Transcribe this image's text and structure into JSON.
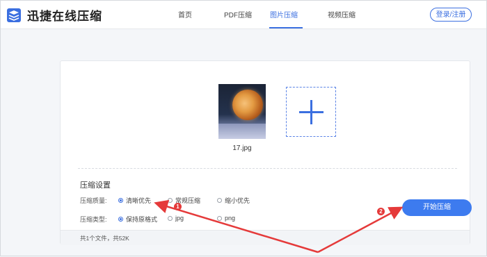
{
  "header": {
    "brand": "迅捷在线压缩",
    "nav": [
      {
        "label": "首页",
        "active": false
      },
      {
        "label": "PDF压缩",
        "active": false
      },
      {
        "label": "图片压缩",
        "active": true
      },
      {
        "label": "视频压缩",
        "active": false
      }
    ],
    "login_label": "登录/注册"
  },
  "upload": {
    "file_name": "17.jpg",
    "add_icon": "plus-icon"
  },
  "settings": {
    "title": "压缩设置",
    "quality_label": "压缩质量:",
    "quality_options": [
      {
        "label": "清晰优先",
        "selected": true
      },
      {
        "label": "常规压缩",
        "selected": false
      },
      {
        "label": "缩小优先",
        "selected": false
      }
    ],
    "type_label": "压缩类型:",
    "type_options": [
      {
        "label": "保持原格式",
        "selected": true
      },
      {
        "label": "jpg",
        "selected": false
      },
      {
        "label": "png",
        "selected": false
      }
    ],
    "start_label": "开始压缩"
  },
  "footer": {
    "summary": "共1个文件，共52K"
  },
  "annotations": {
    "badge_1": "1",
    "badge_2": "2"
  },
  "colors": {
    "accent": "#3b6fe0",
    "button": "#3d7bef",
    "annotation": "#e53a3a"
  }
}
